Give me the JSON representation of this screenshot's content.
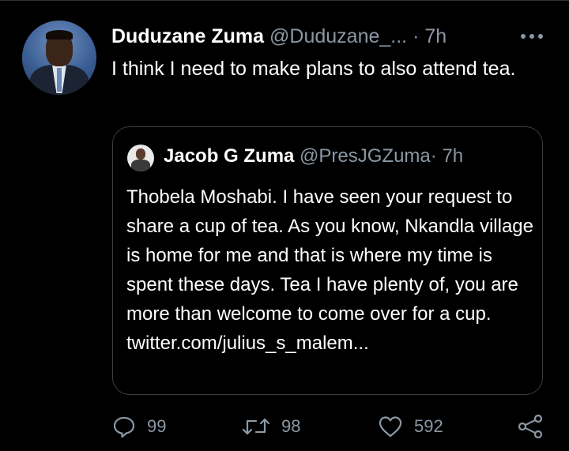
{
  "tweet": {
    "author_name": "Duduzane Zuma",
    "author_handle": "@Duduzane_...",
    "separator": "·",
    "time": "7h",
    "text": "I think I need to make plans to also attend tea."
  },
  "quoted_tweet": {
    "author_name": "Jacob G Zuma",
    "author_handle": "@PresJGZuma",
    "separator": "·",
    "time": "7h",
    "text": "Thobela Moshabi. I have seen your request to share a cup of tea. As you know, Nkandla village is home for me and that is where my time is spent these days. Tea I have plenty of, you are more than welcome to come over for a cup. twitter.com/julius_s_malem..."
  },
  "actions": {
    "reply_count": "99",
    "retweet_count": "98",
    "like_count": "592"
  },
  "icons": {
    "more": "more-icon",
    "reply": "reply-icon",
    "retweet": "retweet-icon",
    "like": "heart-icon",
    "share": "share-icon"
  },
  "colors": {
    "background": "#000000",
    "primary_text": "#ffffff",
    "secondary_text": "#8b98a5",
    "border": "#3a3f44"
  }
}
